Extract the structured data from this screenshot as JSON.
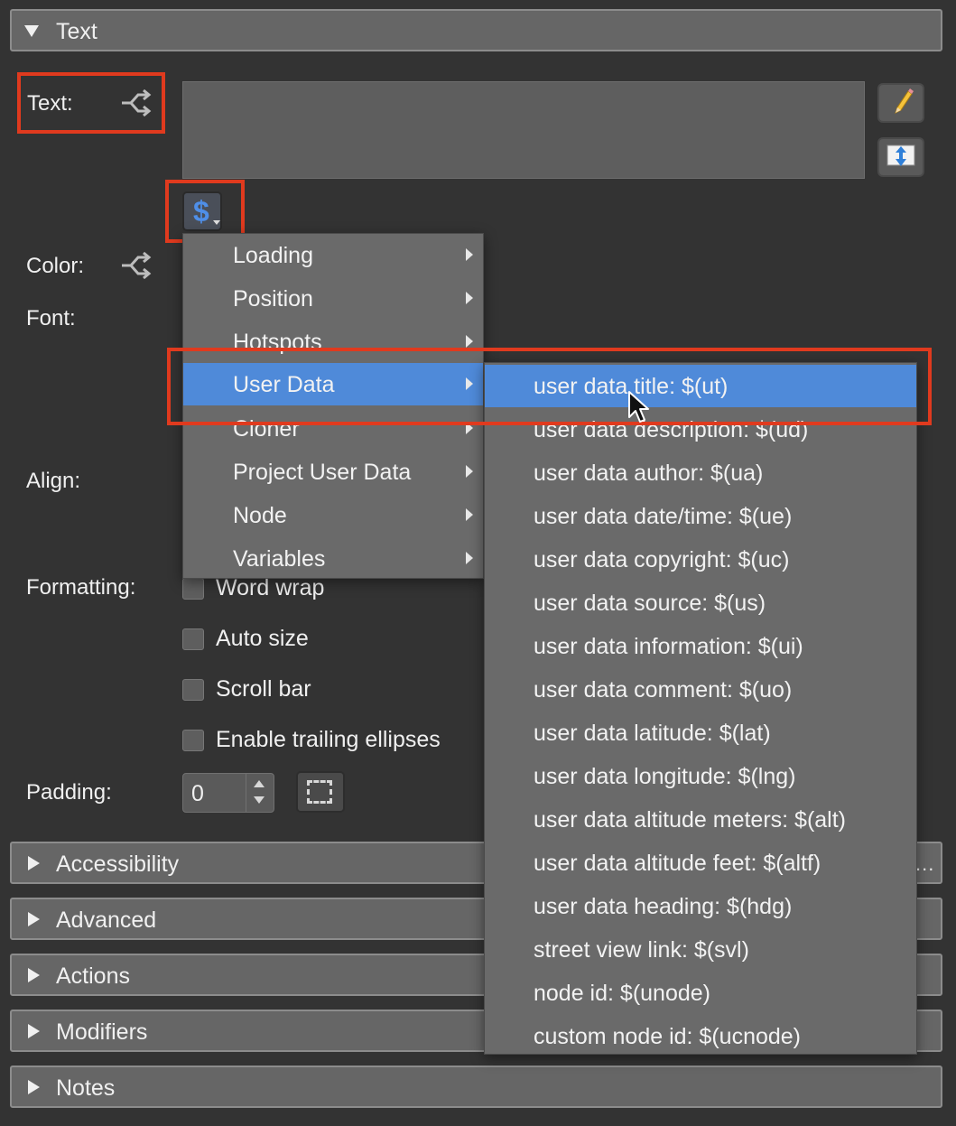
{
  "sections": {
    "text_header": "Text",
    "collapsed": [
      "Accessibility",
      "Advanced",
      "Actions",
      "Modifiers",
      "Notes"
    ]
  },
  "fields": {
    "text_label": "Text:",
    "color_label": "Color:",
    "font_label": "Font:",
    "align_label": "Align:",
    "formatting_label": "Formatting:",
    "padding_label": "Padding:",
    "padding_value": "0"
  },
  "text_value": "",
  "dollar_button": "$",
  "checkboxes": [
    {
      "label": "Word wrap",
      "checked": false
    },
    {
      "label": "Auto size",
      "checked": false
    },
    {
      "label": "Scroll bar",
      "checked": false
    },
    {
      "label": "Enable trailing ellipses",
      "checked": false
    }
  ],
  "menu": {
    "items": [
      "Loading",
      "Position",
      "Hotspots",
      "User Data",
      "Cloner",
      "Project User Data",
      "Node",
      "Variables"
    ],
    "active": "User Data"
  },
  "submenu": {
    "items": [
      "user data title: $(ut)",
      "user data description: $(ud)",
      "user data author: $(ua)",
      "user data date/time: $(ue)",
      "user data copyright: $(uc)",
      "user data source: $(us)",
      "user data information: $(ui)",
      "user data comment: $(uo)",
      "user data latitude: $(lat)",
      "user data longitude: $(lng)",
      "user data altitude meters: $(alt)",
      "user data altitude feet: $(altf)",
      "user data heading: $(hdg)",
      "street view link: $(svl)",
      "node id: $(unode)",
      "custom node id: $(ucnode)"
    ],
    "active": "user data title: $(ut)"
  },
  "overflow_indicator": "...",
  "colors": {
    "background": "#333333",
    "header": "#666666",
    "menu": "#6a6a6a",
    "highlight": "#4f8ad9",
    "annotation": "#e03a1e",
    "dollar": "#4f8fe8"
  }
}
